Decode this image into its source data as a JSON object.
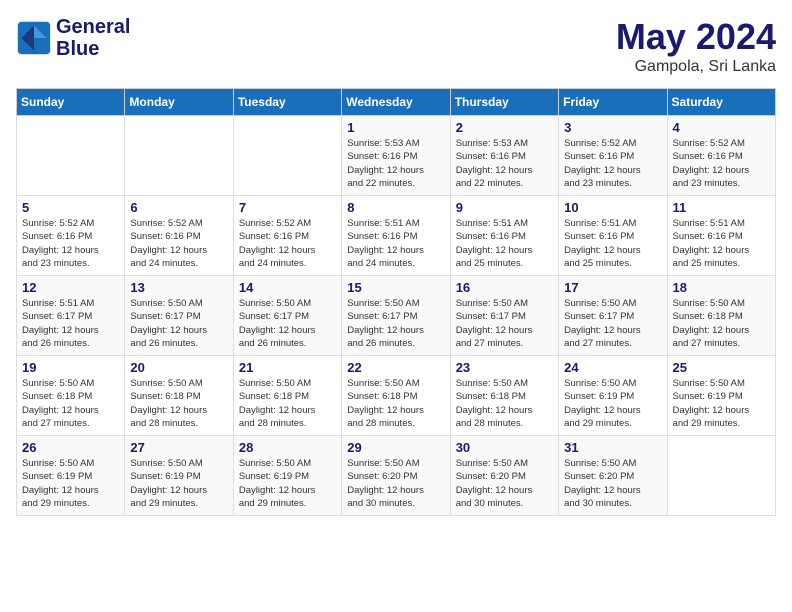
{
  "logo": {
    "text_line1": "General",
    "text_line2": "Blue"
  },
  "header": {
    "month": "May 2024",
    "location": "Gampola, Sri Lanka"
  },
  "weekdays": [
    "Sunday",
    "Monday",
    "Tuesday",
    "Wednesday",
    "Thursday",
    "Friday",
    "Saturday"
  ],
  "weeks": [
    [
      {
        "day": "",
        "info": ""
      },
      {
        "day": "",
        "info": ""
      },
      {
        "day": "",
        "info": ""
      },
      {
        "day": "1",
        "info": "Sunrise: 5:53 AM\nSunset: 6:16 PM\nDaylight: 12 hours\nand 22 minutes."
      },
      {
        "day": "2",
        "info": "Sunrise: 5:53 AM\nSunset: 6:16 PM\nDaylight: 12 hours\nand 22 minutes."
      },
      {
        "day": "3",
        "info": "Sunrise: 5:52 AM\nSunset: 6:16 PM\nDaylight: 12 hours\nand 23 minutes."
      },
      {
        "day": "4",
        "info": "Sunrise: 5:52 AM\nSunset: 6:16 PM\nDaylight: 12 hours\nand 23 minutes."
      }
    ],
    [
      {
        "day": "5",
        "info": "Sunrise: 5:52 AM\nSunset: 6:16 PM\nDaylight: 12 hours\nand 23 minutes."
      },
      {
        "day": "6",
        "info": "Sunrise: 5:52 AM\nSunset: 6:16 PM\nDaylight: 12 hours\nand 24 minutes."
      },
      {
        "day": "7",
        "info": "Sunrise: 5:52 AM\nSunset: 6:16 PM\nDaylight: 12 hours\nand 24 minutes."
      },
      {
        "day": "8",
        "info": "Sunrise: 5:51 AM\nSunset: 6:16 PM\nDaylight: 12 hours\nand 24 minutes."
      },
      {
        "day": "9",
        "info": "Sunrise: 5:51 AM\nSunset: 6:16 PM\nDaylight: 12 hours\nand 25 minutes."
      },
      {
        "day": "10",
        "info": "Sunrise: 5:51 AM\nSunset: 6:16 PM\nDaylight: 12 hours\nand 25 minutes."
      },
      {
        "day": "11",
        "info": "Sunrise: 5:51 AM\nSunset: 6:16 PM\nDaylight: 12 hours\nand 25 minutes."
      }
    ],
    [
      {
        "day": "12",
        "info": "Sunrise: 5:51 AM\nSunset: 6:17 PM\nDaylight: 12 hours\nand 26 minutes."
      },
      {
        "day": "13",
        "info": "Sunrise: 5:50 AM\nSunset: 6:17 PM\nDaylight: 12 hours\nand 26 minutes."
      },
      {
        "day": "14",
        "info": "Sunrise: 5:50 AM\nSunset: 6:17 PM\nDaylight: 12 hours\nand 26 minutes."
      },
      {
        "day": "15",
        "info": "Sunrise: 5:50 AM\nSunset: 6:17 PM\nDaylight: 12 hours\nand 26 minutes."
      },
      {
        "day": "16",
        "info": "Sunrise: 5:50 AM\nSunset: 6:17 PM\nDaylight: 12 hours\nand 27 minutes."
      },
      {
        "day": "17",
        "info": "Sunrise: 5:50 AM\nSunset: 6:17 PM\nDaylight: 12 hours\nand 27 minutes."
      },
      {
        "day": "18",
        "info": "Sunrise: 5:50 AM\nSunset: 6:18 PM\nDaylight: 12 hours\nand 27 minutes."
      }
    ],
    [
      {
        "day": "19",
        "info": "Sunrise: 5:50 AM\nSunset: 6:18 PM\nDaylight: 12 hours\nand 27 minutes."
      },
      {
        "day": "20",
        "info": "Sunrise: 5:50 AM\nSunset: 6:18 PM\nDaylight: 12 hours\nand 28 minutes."
      },
      {
        "day": "21",
        "info": "Sunrise: 5:50 AM\nSunset: 6:18 PM\nDaylight: 12 hours\nand 28 minutes."
      },
      {
        "day": "22",
        "info": "Sunrise: 5:50 AM\nSunset: 6:18 PM\nDaylight: 12 hours\nand 28 minutes."
      },
      {
        "day": "23",
        "info": "Sunrise: 5:50 AM\nSunset: 6:18 PM\nDaylight: 12 hours\nand 28 minutes."
      },
      {
        "day": "24",
        "info": "Sunrise: 5:50 AM\nSunset: 6:19 PM\nDaylight: 12 hours\nand 29 minutes."
      },
      {
        "day": "25",
        "info": "Sunrise: 5:50 AM\nSunset: 6:19 PM\nDaylight: 12 hours\nand 29 minutes."
      }
    ],
    [
      {
        "day": "26",
        "info": "Sunrise: 5:50 AM\nSunset: 6:19 PM\nDaylight: 12 hours\nand 29 minutes."
      },
      {
        "day": "27",
        "info": "Sunrise: 5:50 AM\nSunset: 6:19 PM\nDaylight: 12 hours\nand 29 minutes."
      },
      {
        "day": "28",
        "info": "Sunrise: 5:50 AM\nSunset: 6:19 PM\nDaylight: 12 hours\nand 29 minutes."
      },
      {
        "day": "29",
        "info": "Sunrise: 5:50 AM\nSunset: 6:20 PM\nDaylight: 12 hours\nand 30 minutes."
      },
      {
        "day": "30",
        "info": "Sunrise: 5:50 AM\nSunset: 6:20 PM\nDaylight: 12 hours\nand 30 minutes."
      },
      {
        "day": "31",
        "info": "Sunrise: 5:50 AM\nSunset: 6:20 PM\nDaylight: 12 hours\nand 30 minutes."
      },
      {
        "day": "",
        "info": ""
      }
    ]
  ]
}
